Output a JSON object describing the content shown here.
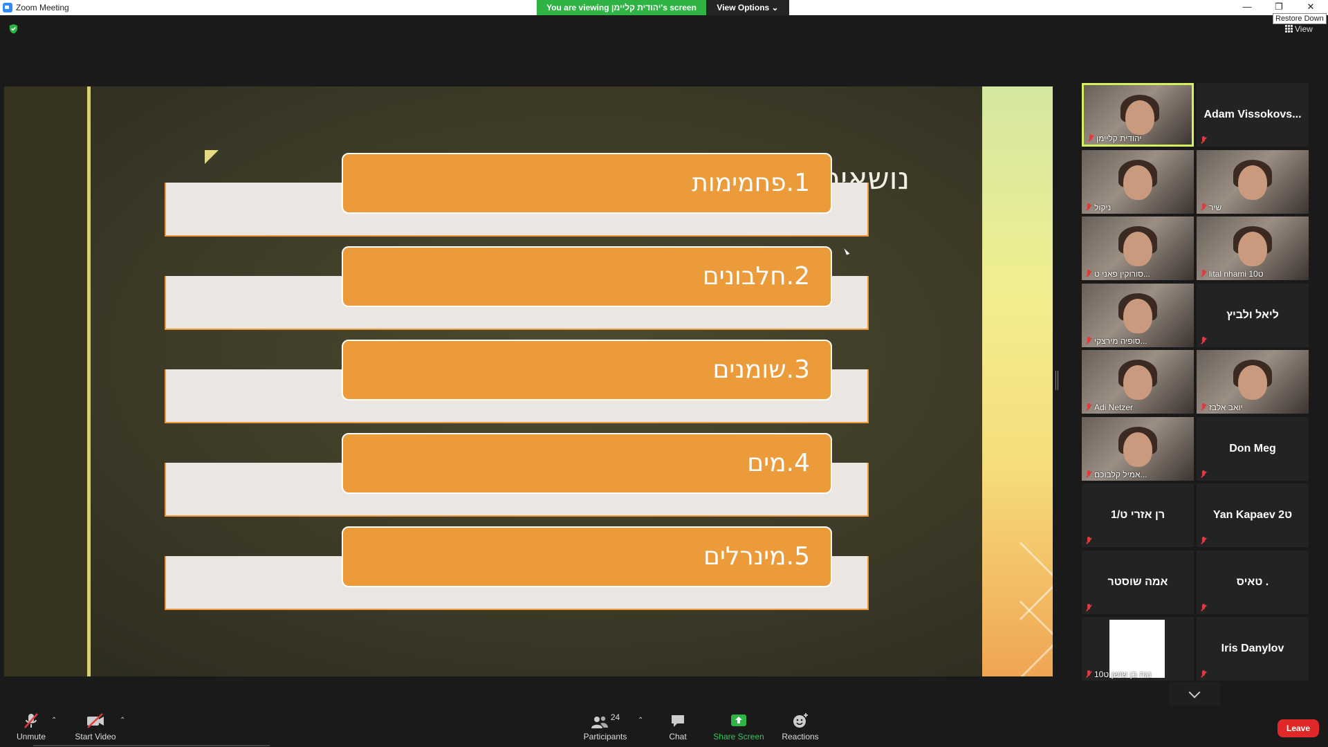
{
  "window": {
    "title": "Zoom Meeting",
    "minimize_icon": "minimize-icon",
    "restore_icon": "restore-icon",
    "close_icon": "close-icon",
    "restore_tooltip": "Restore Down"
  },
  "banner": {
    "viewing_text": "You are viewing יהודית קליימן's screen",
    "view_options": "View Options ⌄",
    "accent": "#2fb344"
  },
  "top_right": {
    "view_label": "View"
  },
  "slide": {
    "heading": "נושאים",
    "items": [
      "1.פחמימות",
      "2.חלבונים",
      "3.שומנים",
      "4.מים",
      "5.מינרלים"
    ],
    "pill_color": "#ec9b3b"
  },
  "gallery": {
    "tiles": [
      {
        "name": "",
        "label": "יהודית קליימן",
        "video": true,
        "active": true
      },
      {
        "name": "Adam  Vissokovs...",
        "label": "",
        "video": false
      },
      {
        "name": "",
        "label": "ניקול",
        "video": true
      },
      {
        "name": "",
        "label": "שיר",
        "video": true
      },
      {
        "name": "",
        "label": "סורוקין פאני ט...",
        "video": true
      },
      {
        "name": "",
        "label": "lital nhami 10ט",
        "video": true
      },
      {
        "name": "",
        "label": "סופיה מירצקי...",
        "video": true
      },
      {
        "name": "ליאל ולביץ",
        "label": "",
        "video": false
      },
      {
        "name": "",
        "label": "Adi Netzer",
        "video": true
      },
      {
        "name": "",
        "label": "יואב אלבז",
        "video": true
      },
      {
        "name": "",
        "label": "אמיל קלבוכם...",
        "video": true
      },
      {
        "name": "Don Meg",
        "label": "",
        "video": false
      },
      {
        "name": "רן אזרי ט/1",
        "label": "",
        "video": false
      },
      {
        "name": "Yan  Kapaev 2ט",
        "label": "",
        "video": false
      },
      {
        "name": "אמה שוסטר",
        "label": "",
        "video": false
      },
      {
        "name": "טאיס .",
        "label": "",
        "video": false
      },
      {
        "name": "",
        "label": "נגה בן שושן ט10",
        "video": "white"
      },
      {
        "name": "Iris Danylov",
        "label": "",
        "video": false
      }
    ]
  },
  "toolbar": {
    "unmute": "Unmute",
    "start_video": "Start Video",
    "participants": "Participants",
    "participants_count": "24",
    "chat": "Chat",
    "share_screen": "Share Screen",
    "reactions": "Reactions",
    "leave": "Leave",
    "leave_color": "#e02828"
  }
}
